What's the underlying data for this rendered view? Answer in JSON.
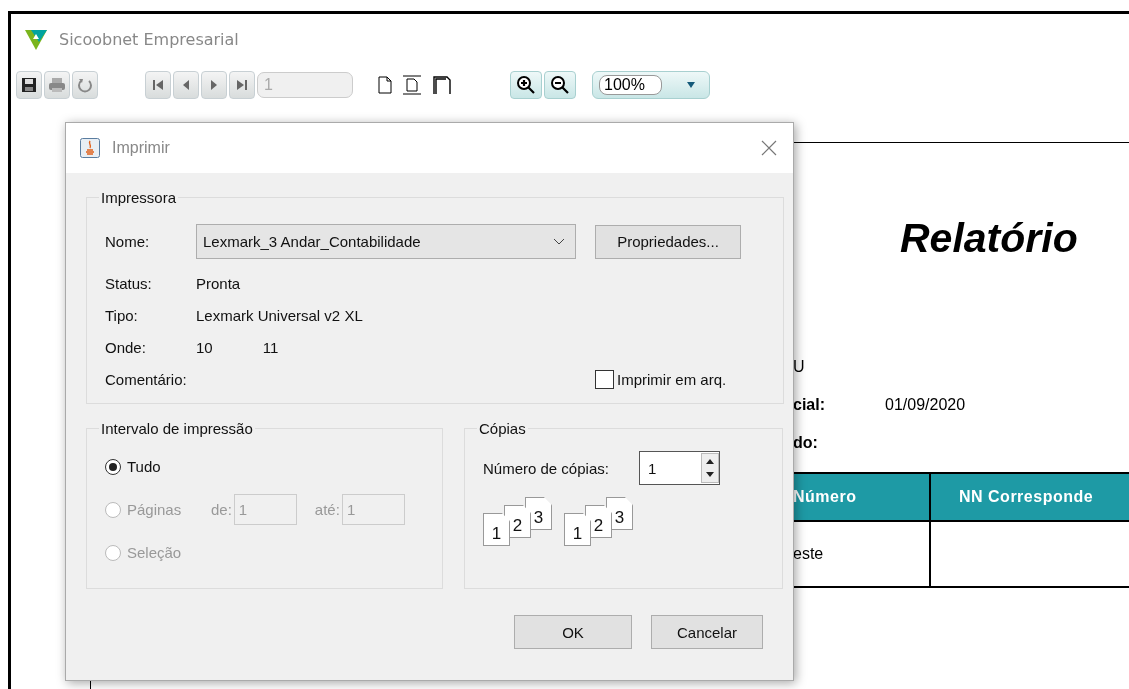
{
  "window": {
    "title": "Sicoobnet Empresarial"
  },
  "toolbar": {
    "page_field": "1",
    "zoom": "100%"
  },
  "report": {
    "title": "Relatório",
    "fields": [
      {
        "kind": "text",
        "label": "U"
      },
      {
        "kind": "field",
        "label": "cial:",
        "value": "01/09/2020"
      },
      {
        "kind": "field",
        "label": "do:"
      }
    ],
    "table": {
      "columns": [
        "Número",
        "NN Corresponde"
      ],
      "rows": [
        [
          "este"
        ]
      ]
    }
  },
  "dialog": {
    "title": "Imprimir",
    "printer": {
      "legend": "Impressora",
      "name_label": "Nome:",
      "name_value": "Lexmark_3 Andar_Contabilidade",
      "properties_button": "Propriedades...",
      "info": [
        {
          "label": "Status:",
          "values": [
            "Pronta"
          ]
        },
        {
          "label": "Tipo:",
          "values": [
            "Lexmark Universal v2 XL"
          ]
        },
        {
          "label": "Onde:",
          "values": [
            "10",
            "11"
          ]
        },
        {
          "label": "Comentário:"
        }
      ],
      "print_to_file": {
        "label": "Imprimir em arq.",
        "checked": false
      }
    },
    "range": {
      "legend": "Intervalo de impressão",
      "options": [
        {
          "label": "Tudo",
          "selected": true,
          "disabled": false
        },
        {
          "label": "Páginas",
          "selected": false,
          "disabled": true,
          "from_label": "de:",
          "from": "1",
          "to_label": "até:",
          "to": "1"
        },
        {
          "label": "Seleção",
          "selected": false,
          "disabled": true
        }
      ]
    },
    "copies": {
      "legend": "Cópias",
      "label": "Número de cópias:",
      "value": "1",
      "collate_icons": [
        {
          "pages": [
            "1",
            "2",
            "3"
          ]
        },
        {
          "pages": [
            "1",
            "2",
            "3"
          ]
        }
      ]
    },
    "buttons": [
      "OK",
      "Cancelar"
    ]
  }
}
